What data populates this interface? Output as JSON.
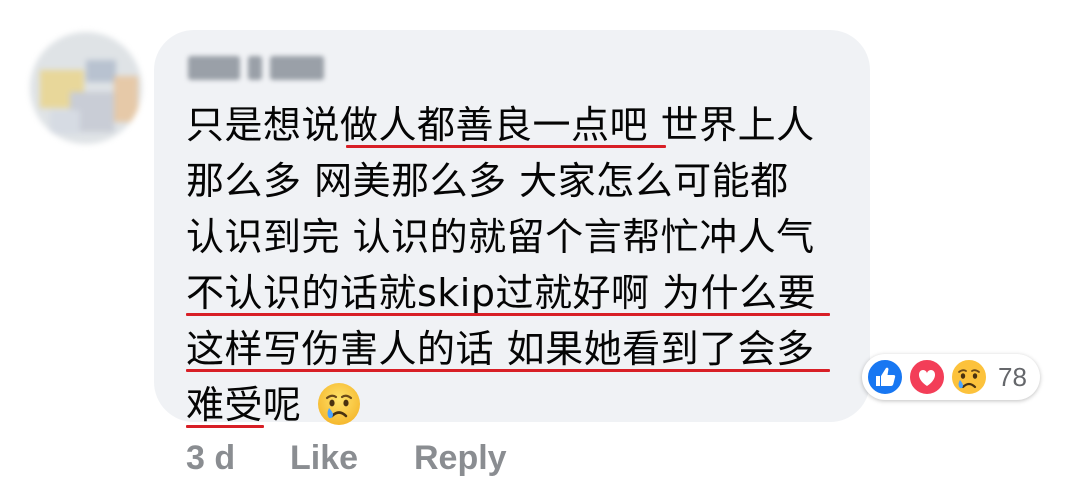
{
  "comment": {
    "author_name": "",
    "lines": [
      "只是想说做人都善良一点吧 世界上人",
      "那么多 网美那么多 大家怎么可能都",
      "认识到完 认识的就留个言帮忙冲人气",
      "不认识的话就skip过就好啊 为什么要",
      "这样写伤害人的话 如果她看到了会多",
      "难受呢"
    ],
    "trailing_emoji": "crying-face-emoji",
    "underline_color": "#d81f26",
    "bubble_color": "#f0f2f5"
  },
  "reactions": {
    "icons": [
      "like-icon",
      "love-icon",
      "sad-icon"
    ],
    "count": "78"
  },
  "actions": {
    "time": "3 d",
    "like_label": "Like",
    "reply_label": "Reply"
  }
}
